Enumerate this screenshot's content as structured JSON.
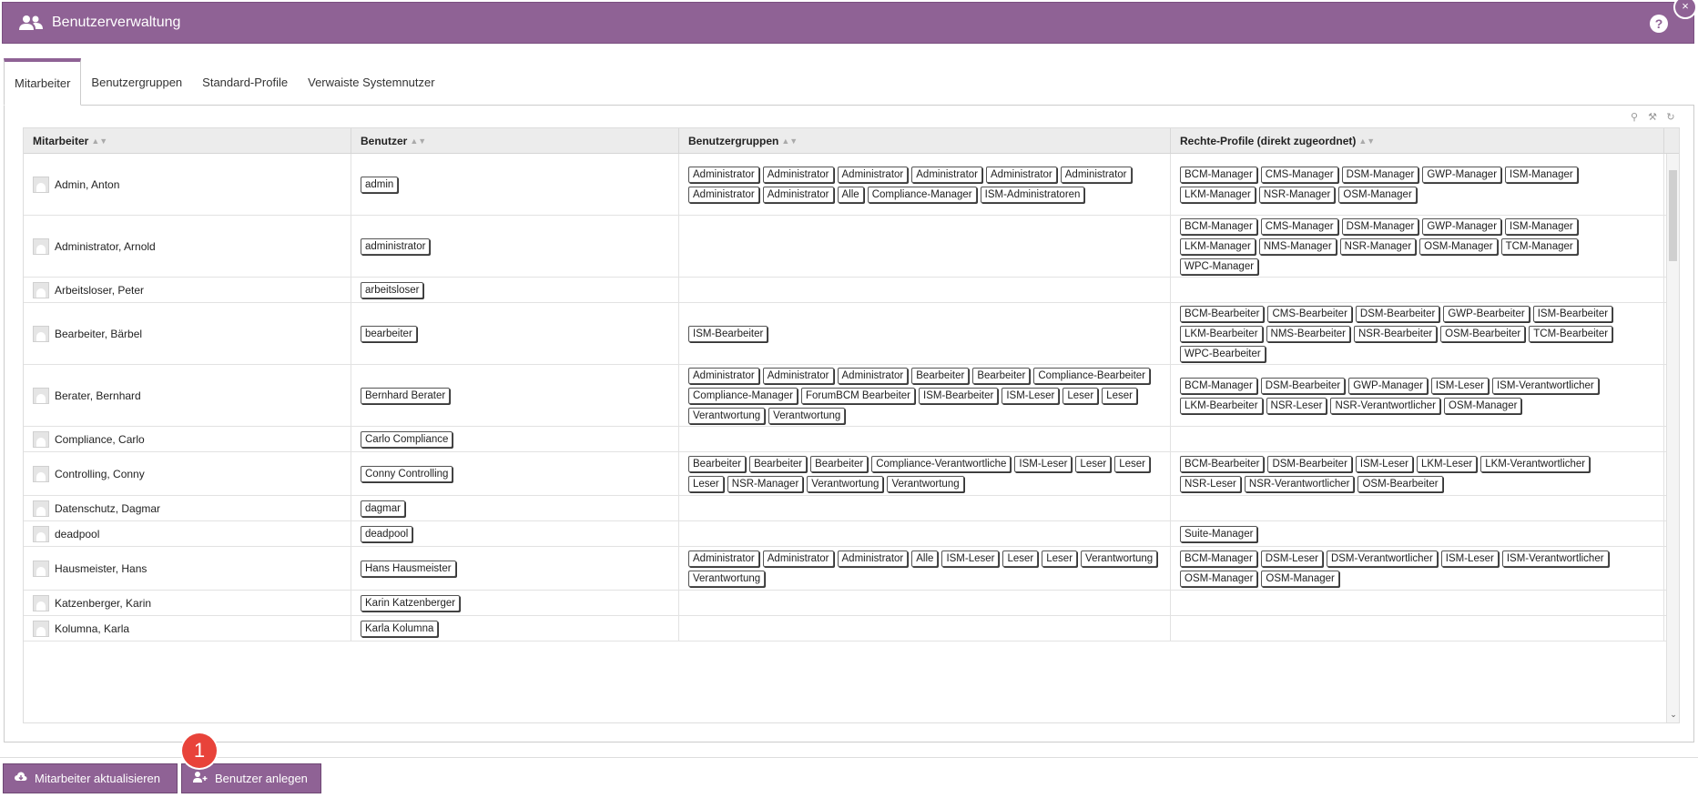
{
  "app": {
    "title": "Benutzerverwaltung"
  },
  "tabs": [
    "Mitarbeiter",
    "Benutzergruppen",
    "Standard-Profile",
    "Verwaiste Systemnutzer"
  ],
  "active_tab": "Mitarbeiter",
  "columns": [
    "Mitarbeiter",
    "Benutzer",
    "Benutzergruppen",
    "Rechte-Profile (direkt zugeordnet)"
  ],
  "rows": [
    {
      "name": "Admin, Anton",
      "user": "admin",
      "groups": [
        "Administrator",
        "Administrator",
        "Administrator",
        "Administrator",
        "Administrator",
        "Administrator",
        "Administrator",
        "Administrator",
        "Alle",
        "Compliance-Manager",
        "ISM-Administratoren"
      ],
      "profiles": [
        "BCM-Manager",
        "CMS-Manager",
        "DSM-Manager",
        "GWP-Manager",
        "ISM-Manager",
        "LKM-Manager",
        "NSR-Manager",
        "OSM-Manager"
      ]
    },
    {
      "name": "Administrator, Arnold",
      "user": "administrator",
      "groups": [],
      "profiles": [
        "BCM-Manager",
        "CMS-Manager",
        "DSM-Manager",
        "GWP-Manager",
        "ISM-Manager",
        "LKM-Manager",
        "NMS-Manager",
        "NSR-Manager",
        "OSM-Manager",
        "TCM-Manager",
        "WPC-Manager"
      ]
    },
    {
      "name": "Arbeitsloser, Peter",
      "user": "arbeitsloser",
      "groups": [],
      "profiles": []
    },
    {
      "name": "Bearbeiter, Bärbel",
      "user": "bearbeiter",
      "groups": [
        "ISM-Bearbeiter"
      ],
      "profiles": [
        "BCM-Bearbeiter",
        "CMS-Bearbeiter",
        "DSM-Bearbeiter",
        "GWP-Bearbeiter",
        "ISM-Bearbeiter",
        "LKM-Bearbeiter",
        "NMS-Bearbeiter",
        "NSR-Bearbeiter",
        "OSM-Bearbeiter",
        "TCM-Bearbeiter",
        "WPC-Bearbeiter"
      ]
    },
    {
      "name": "Berater, Bernhard",
      "user": "Bernhard Berater",
      "groups": [
        "Administrator",
        "Administrator",
        "Administrator",
        "Bearbeiter",
        "Bearbeiter",
        "Compliance-Bearbeiter",
        "Compliance-Manager",
        "ForumBCM Bearbeiter",
        "ISM-Bearbeiter",
        "ISM-Leser",
        "Leser",
        "Leser",
        "Verantwortung",
        "Verantwortung"
      ],
      "profiles": [
        "BCM-Manager",
        "DSM-Bearbeiter",
        "GWP-Manager",
        "ISM-Leser",
        "ISM-Verantwortlicher",
        "LKM-Bearbeiter",
        "NSR-Leser",
        "NSR-Verantwortlicher",
        "OSM-Manager"
      ]
    },
    {
      "name": "Compliance, Carlo",
      "user": "Carlo Compliance",
      "groups": [],
      "profiles": []
    },
    {
      "name": "Controlling, Conny",
      "user": "Conny Controlling",
      "groups": [
        "Bearbeiter",
        "Bearbeiter",
        "Bearbeiter",
        "Compliance-Verantwortliche",
        "ISM-Leser",
        "Leser",
        "Leser",
        "Leser",
        "NSR-Manager",
        "Verantwortung",
        "Verantwortung"
      ],
      "profiles": [
        "BCM-Bearbeiter",
        "DSM-Bearbeiter",
        "ISM-Leser",
        "LKM-Leser",
        "LKM-Verantwortlicher",
        "NSR-Leser",
        "NSR-Verantwortlicher",
        "OSM-Bearbeiter"
      ]
    },
    {
      "name": "Datenschutz, Dagmar",
      "user": "dagmar",
      "groups": [],
      "profiles": []
    },
    {
      "name": "deadpool",
      "user": "deadpool",
      "groups": [],
      "profiles": [
        "Suite-Manager"
      ]
    },
    {
      "name": "Hausmeister, Hans",
      "user": "Hans Hausmeister",
      "groups": [
        "Administrator",
        "Administrator",
        "Administrator",
        "Alle",
        "ISM-Leser",
        "Leser",
        "Leser",
        "Verantwortung",
        "Verantwortung"
      ],
      "profiles": [
        "BCM-Manager",
        "DSM-Leser",
        "DSM-Verantwortlicher",
        "ISM-Leser",
        "ISM-Verantwortlicher",
        "OSM-Manager",
        "OSM-Manager"
      ]
    },
    {
      "name": "Katzenberger, Karin",
      "user": "Karin Katzenberger",
      "groups": [],
      "profiles": []
    },
    {
      "name": "Kolumna, Karla",
      "user": "Karla Kolumna",
      "groups": [],
      "profiles": []
    }
  ],
  "buttons": {
    "update": "Mitarbeiter aktualisieren",
    "create_user": "Benutzer anlegen"
  },
  "badge": "1",
  "icons": {
    "help": "?",
    "close": "×"
  },
  "colors": {
    "accent": "#8f6295",
    "badge": "#e8433a"
  }
}
